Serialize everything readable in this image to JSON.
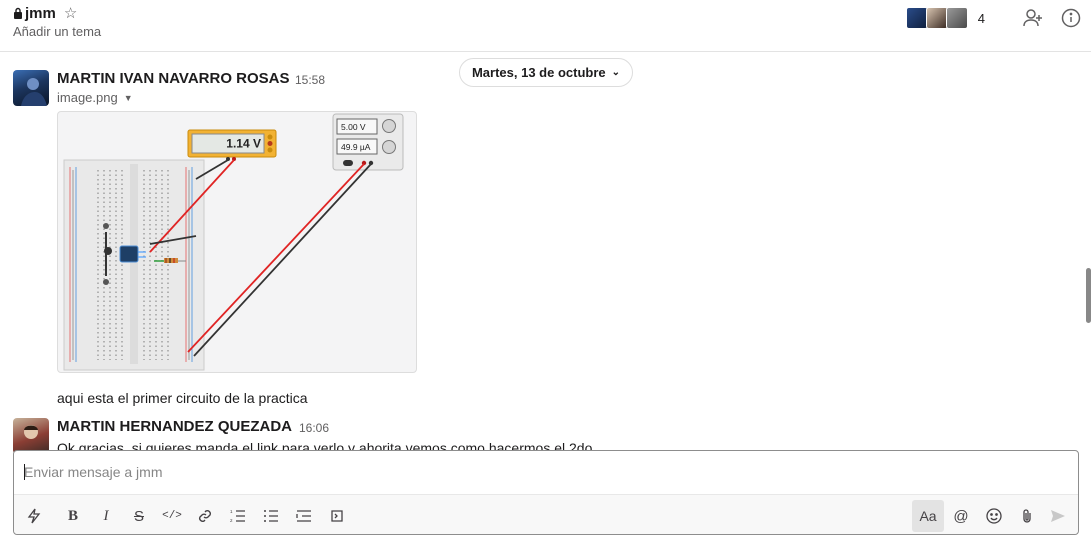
{
  "header": {
    "channel_name": "jmm",
    "topic": "Añadir un tema",
    "member_count": "4",
    "icons": [
      "lock-icon",
      "star-icon",
      "add-member-icon",
      "info-icon"
    ]
  },
  "date_divider": {
    "label": "Martes, 13 de octubre"
  },
  "messages": [
    {
      "sender": "MARTIN IVAN NAVARRO ROSAS",
      "time": "15:58",
      "file_name": "image.png",
      "text": "aqui esta el primer circuito de la practica",
      "attachment": {
        "multimeter_value": "1.14 V",
        "supply_voltage": "5.00 V",
        "supply_current": "49.9 µA"
      }
    },
    {
      "sender": "MARTIN HERNANDEZ QUEZADA",
      "time": "16:06",
      "text": "Ok gracias, si quieres manda el link para verlo y ahorita vemos como hacermos el 2do"
    }
  ],
  "composer": {
    "placeholder": "Enviar mensaje a jmm",
    "format_label": "Aa"
  },
  "colors": {
    "accent": "#1264a3",
    "multimeter": "#f2b233",
    "wire_red": "#e02424",
    "wire_black": "#222222"
  }
}
